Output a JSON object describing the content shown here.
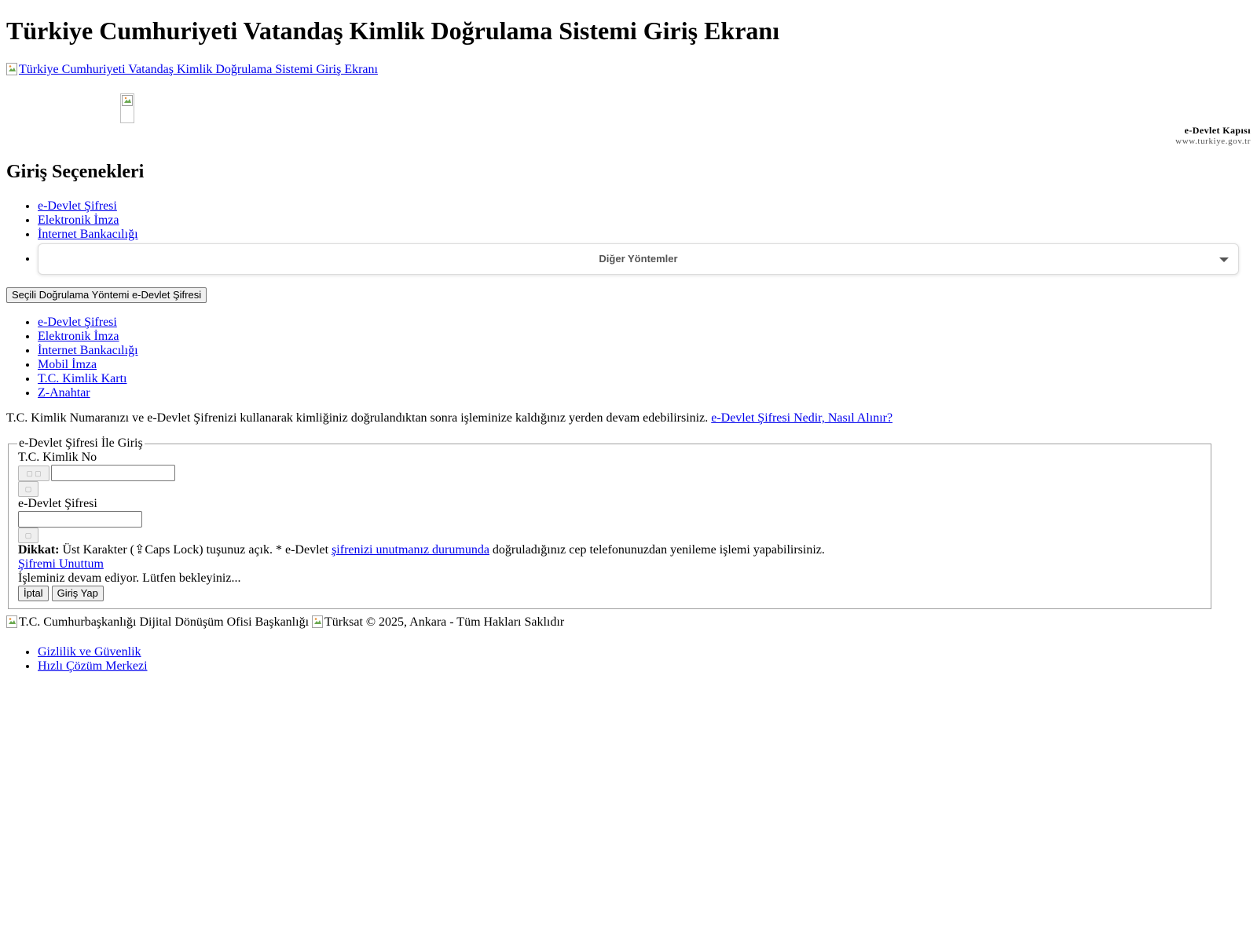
{
  "page_title": "Türkiye Cumhuriyeti Vatandaş Kimlik Doğrulama Sistemi Giriş Ekranı",
  "logo_alt": "Türkiye Cumhuriyeti Vatandaş Kimlik Doğrulama Sistemi Giriş Ekranı",
  "brand": {
    "title": "e-Devlet Kapısı",
    "url": "www.turkiye.gov.tr"
  },
  "options": {
    "heading": "Giriş Seçenekleri",
    "items": [
      "e-Devlet Şifresi",
      "Elektronik İmza",
      "İnternet Bankacılığı"
    ],
    "dropdown_label": "Diğer Yöntemler"
  },
  "selected_method_button": "Seçili Doğrulama Yöntemi e-Devlet Şifresi",
  "methods": [
    "e-Devlet Şifresi",
    "Elektronik İmza",
    "İnternet Bankacılığı",
    "Mobil İmza",
    "T.C. Kimlik Kartı",
    "Z-Anahtar"
  ],
  "info": {
    "text": "T.C. Kimlik Numaranızı ve e-Devlet Şifrenizi kullanarak kimliğiniz doğrulandıktan sonra işleminize kaldığınız yerden devam edebilirsiniz.",
    "link": "e-Devlet Şifresi Nedir, Nasıl Alınır?"
  },
  "login_form": {
    "legend": "e-Devlet Şifresi İle Giriş",
    "tc_label": "T.C. Kimlik No",
    "tc_value": "",
    "password_label": "e-Devlet Şifresi",
    "password_value": "",
    "warning_strong": "Dikkat:",
    "warning_text_1": "Üst Karakter (⇪Caps Lock) tuşunuz açık. * e-Devlet",
    "warning_link": "şifrenizi unutmanız durumunda",
    "warning_text_2": "doğruladığınız cep telefonunuzdan yenileme işlemi yapabilirsiniz.",
    "forgot_link": "Şifremi Unuttum",
    "processing_text": "İşleminiz devam ediyor. Lütfen bekleyiniz...",
    "cancel_button": "İptal",
    "submit_button": "Giriş Yap"
  },
  "footer": {
    "img1_alt": "T.C. Cumhurbaşkanlığı Dijital Dönüşüm Ofisi Başkanlığı",
    "img2_alt": "Türksat",
    "copyright": "© 2025, Ankara - Tüm Hakları Saklıdır",
    "links": [
      "Gizlilik ve Güvenlik",
      "Hızlı Çözüm Merkezi"
    ]
  }
}
